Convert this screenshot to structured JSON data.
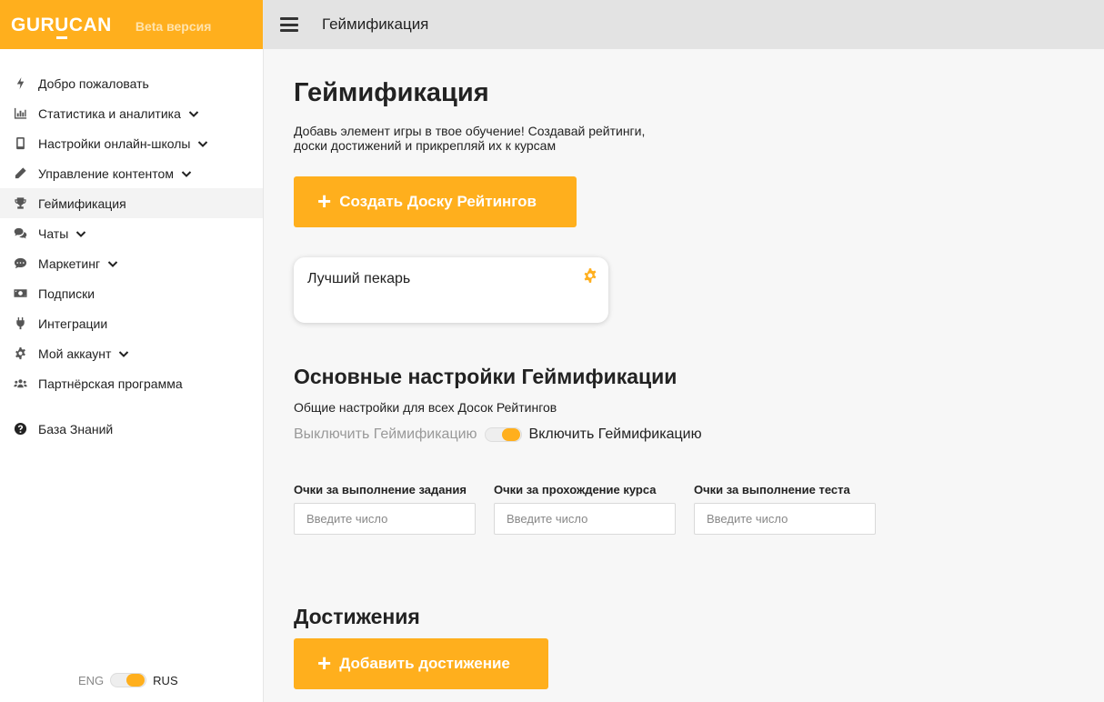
{
  "brand": {
    "logo": "GURUCAN",
    "beta": "Beta версия"
  },
  "topbar": {
    "title": "Геймификация"
  },
  "sidebar": {
    "items": [
      {
        "label": "Добро пожаловать",
        "icon": "bolt-icon",
        "has_chevron": false,
        "active": false
      },
      {
        "label": "Статистика и аналитика",
        "icon": "chart-icon",
        "has_chevron": true,
        "active": false
      },
      {
        "label": "Настройки онлайн-школы",
        "icon": "phone-icon",
        "has_chevron": true,
        "active": false
      },
      {
        "label": "Управление контентом",
        "icon": "pencil-icon",
        "has_chevron": true,
        "active": false
      },
      {
        "label": "Геймификация",
        "icon": "trophy-icon",
        "has_chevron": false,
        "active": true
      },
      {
        "label": "Чаты",
        "icon": "chat-icon",
        "has_chevron": true,
        "active": false
      },
      {
        "label": "Маркетинг",
        "icon": "comment-icon",
        "has_chevron": true,
        "active": false
      },
      {
        "label": "Подписки",
        "icon": "money-icon",
        "has_chevron": false,
        "active": false
      },
      {
        "label": "Интеграции",
        "icon": "plug-icon",
        "has_chevron": false,
        "active": false
      },
      {
        "label": "Мой аккаунт",
        "icon": "gear-icon",
        "has_chevron": true,
        "active": false
      },
      {
        "label": "Партнёрская программа",
        "icon": "users-icon",
        "has_chevron": false,
        "active": false
      }
    ],
    "knowledge_base": {
      "label": "База Знаний",
      "icon": "question-icon"
    },
    "lang": {
      "eng": "ENG",
      "rus": "RUS",
      "selected": "RUS"
    }
  },
  "main": {
    "title": "Геймификация",
    "description": "Добавь элемент игры в твое обучение! Создавай рейтинги, доски достижений и прикрепляй их к курсам",
    "create_button": "Создать Доску Рейтингов",
    "boards": [
      {
        "name": "Лучший пекарь"
      }
    ],
    "settings": {
      "title": "Основные настройки Геймификации",
      "subtitle": "Общие настройки для всех Досок Рейтингов",
      "switch_off_label": "Выключить Геймификацию",
      "switch_on_label": "Включить Геймификацию",
      "enabled": true,
      "fields": [
        {
          "label": "Очки за выполнение задания",
          "placeholder": "Введите число",
          "value": ""
        },
        {
          "label": "Очки за прохождение курса",
          "placeholder": "Введите число",
          "value": ""
        },
        {
          "label": "Очки за выполнение теста",
          "placeholder": "Введите число",
          "value": ""
        }
      ]
    },
    "achievements": {
      "title": "Достижения",
      "add_button": "Добавить достижение"
    }
  },
  "colors": {
    "accent": "#ffaf1d",
    "topbar": "#e3e3e3",
    "background": "#f7f7f7"
  }
}
